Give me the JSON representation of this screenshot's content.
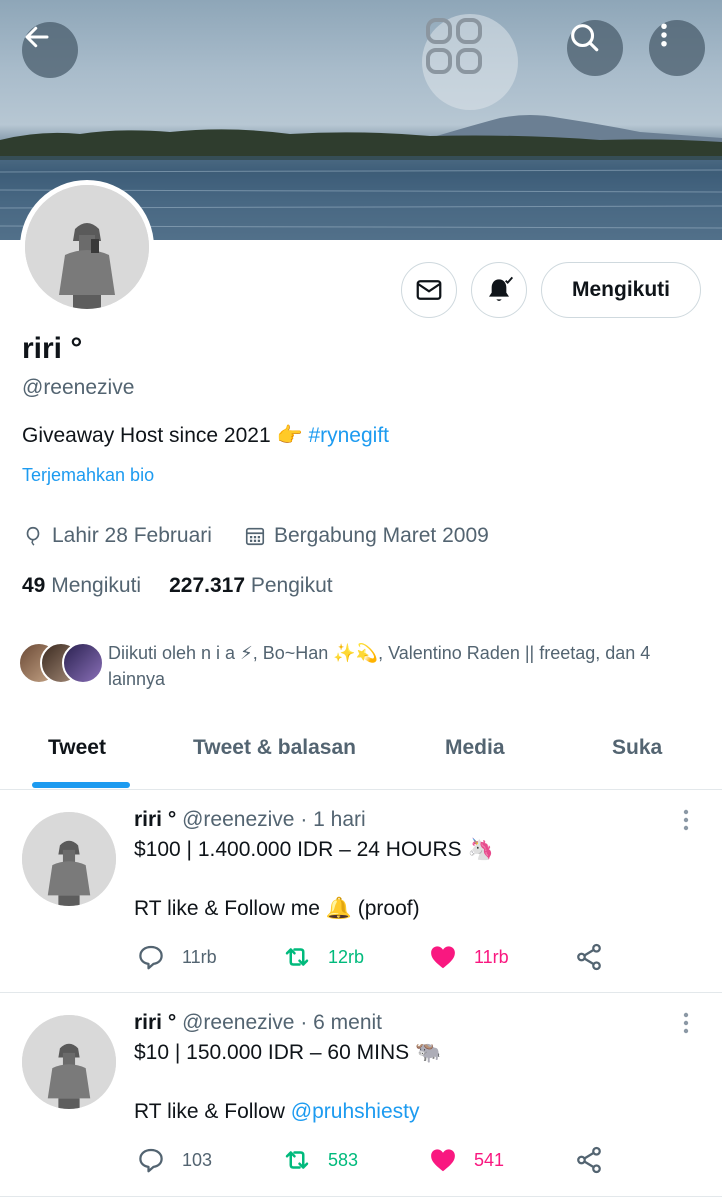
{
  "nav": {
    "back_icon": "arrow-left-icon",
    "grid_icon": "grid-icon",
    "search_icon": "search-icon",
    "more_icon": "more-vertical-icon"
  },
  "profile": {
    "name": "riri °",
    "handle": "@reenezive",
    "bio_text": "Giveaway Host since 2021 👉",
    "bio_hashtag": "#rynegift",
    "translate_label": "Terjemahkan bio",
    "birthday": "Lahir 28 Februari",
    "joined": "Bergabung Maret 2009",
    "following_count": "49",
    "following_label": "Mengikuti",
    "followers_count": "227.317",
    "followers_label": "Pengikut",
    "follow_button_label": "Mengikuti",
    "followed_by": "Diikuti oleh n i a ⚡, Bo~Han ✨💫, Valentino Raden || freetag, dan 4 lainnya"
  },
  "tabs": [
    "Tweet",
    "Tweet & balasan",
    "Media",
    "Suka"
  ],
  "active_tab": "Tweet",
  "colors": {
    "accent": "#1d9bf0",
    "retweet": "#00ba7c",
    "like": "#f91880",
    "muted": "#536471"
  },
  "tweets": [
    {
      "name": "riri °",
      "handle": "@reenezive",
      "time": "· 1 hari",
      "line1": "$100 | 1.400.000 IDR – 24 HOURS 🦄",
      "line2_text": "RT like & Follow me 🔔 (proof)",
      "line2_mention": "",
      "replies": "11rb",
      "retweets": "12rb",
      "likes": "11rb",
      "retweeted": true,
      "liked": true
    },
    {
      "name": "riri °",
      "handle": "@reenezive",
      "time": "· 6 menit",
      "line1": "$10 | 150.000 IDR – 60 MINS 🐃",
      "line2_text": "RT like & Follow ",
      "line2_mention": "@pruhshiesty",
      "replies": "103",
      "retweets": "583",
      "likes": "541",
      "retweeted": true,
      "liked": true
    }
  ]
}
